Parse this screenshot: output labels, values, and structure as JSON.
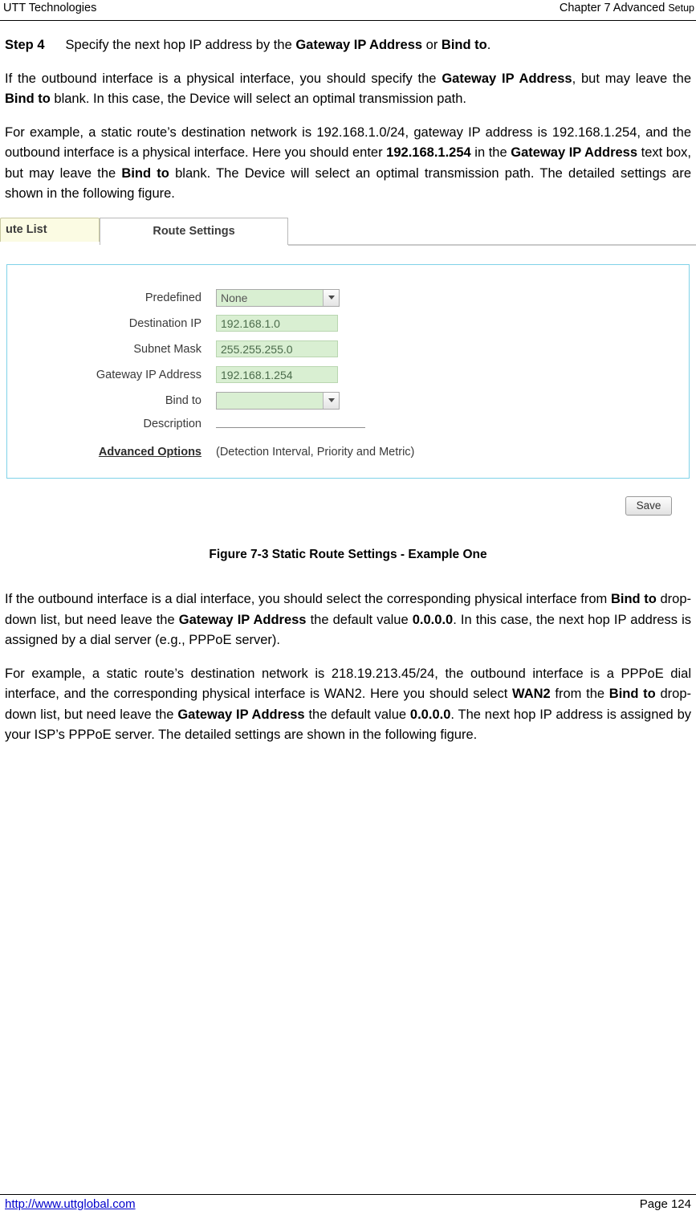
{
  "header": {
    "left": "UTT Technologies",
    "right_main": "Chapter 7 Advanced ",
    "right_small": "Setup"
  },
  "body": {
    "step": {
      "label": "Step 4",
      "text_1": "Specify the next hop IP address by the ",
      "bold_1": "Gateway IP Address",
      "text_2": " or ",
      "bold_2": "Bind to",
      "text_3": "."
    },
    "para_1": {
      "t1": "If the outbound interface is a physical interface, you should specify the ",
      "b1": "Gateway IP Address",
      "t2": ", but may leave the ",
      "b2": "Bind to",
      "t3": " blank. In this case, the Device will select an optimal transmission path."
    },
    "para_2": {
      "t1": "For example, a static route’s destination network is 192.168.1.0/24, gateway IP address is 192.168.1.254, and the outbound interface is a physical interface. Here you should enter ",
      "b1": "192.168.1.254",
      "t2": " in the ",
      "b2": "Gateway IP Address",
      "t3": " text box, but may leave the ",
      "b3": "Bind to",
      "t4": " blank. The Device will select an optimal transmission path. The detailed settings are shown in the following figure."
    },
    "para_3": {
      "t1": "If the outbound interface is a dial interface, you should select the corresponding physical interface from ",
      "b1": "Bind to",
      "t2": " drop-down list, but need leave the ",
      "b2": "Gateway IP Address",
      "t3": " the default value ",
      "b3": "0.0.0.0",
      "t4": ". In this case, the next hop IP address is assigned by a dial server (e.g., PPPoE server)."
    },
    "para_4": {
      "t1": "For example, a static route’s destination network is 218.19.213.45/24, the outbound interface is a PPPoE dial interface, and the corresponding physical interface is WAN2. Here you should select ",
      "b1": "WAN2",
      "t2": " from the ",
      "b2": "Bind to",
      "t3": " drop-down list, but need leave the ",
      "b3": "Gateway IP Address",
      "t4": " the default value ",
      "b4": "0.0.0.0",
      "t5": ". The next hop IP address is assigned by your ISP’s PPPoE server. The detailed settings are shown in the following figure."
    }
  },
  "figure": {
    "tab_inactive": "ute List",
    "tab_active": "Route Settings",
    "fields": {
      "predefined_label": "Predefined",
      "predefined_value": "None",
      "destination_label": "Destination IP",
      "destination_value": "192.168.1.0",
      "subnet_label": "Subnet Mask",
      "subnet_value": "255.255.255.0",
      "gateway_label": "Gateway IP Address",
      "gateway_value": "192.168.1.254",
      "bindto_label": "Bind to",
      "bindto_value": "",
      "description_label": "Description",
      "description_value": "",
      "advanced_label": "Advanced Options",
      "advanced_note": "(Detection Interval, Priority and Metric)"
    },
    "save_button": "Save",
    "caption": "Figure 7-3 Static Route Settings - Example One"
  },
  "footer": {
    "url": "http://www.uttglobal.com",
    "page": "Page 124"
  }
}
